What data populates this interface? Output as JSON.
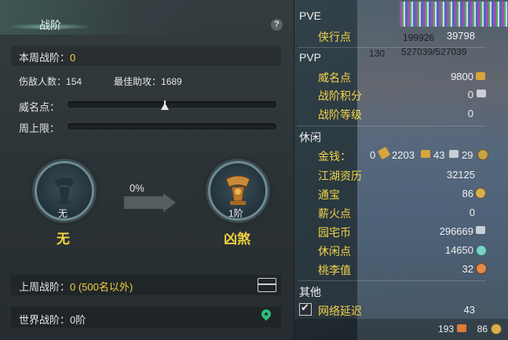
{
  "left": {
    "title": "战阶",
    "help": "?",
    "weekly_rank_label": "本周战阶：",
    "weekly_rank_value": "0",
    "kills_label": "伤敌人数：",
    "kills_value": "154",
    "best_assist_label": "最佳助攻：",
    "best_assist_value": "1689",
    "prestige_label": "威名点：",
    "weekly_cap_label": "周上限：",
    "current_medal_label": "无",
    "current_medal_name": "无",
    "progress_percent": "0%",
    "next_medal_label": "1阶",
    "next_medal_name": "凶煞",
    "last_week_label": "上周战阶：",
    "last_week_value": "0 (500名以外)",
    "world_rank_label": "世界战阶：0阶"
  },
  "right": {
    "pve_header": "PVE",
    "pve_items": [
      {
        "label": "侠行点",
        "value": "39798"
      }
    ],
    "pvp_header": "PVP",
    "pvp_items": [
      {
        "label": "威名点",
        "value": "9800"
      },
      {
        "label": "战阶积分",
        "value": "0"
      },
      {
        "label": "战阶等级",
        "value": "0"
      }
    ],
    "leisure_header": "休闲",
    "gold_label": "金钱：",
    "gold_a": "0",
    "gold_b": "2203",
    "gold_c": "43",
    "gold_d": "29",
    "leisure_items": [
      {
        "label": "江湖资历",
        "value": "32125"
      },
      {
        "label": "通宝",
        "value": "86"
      },
      {
        "label": "薪火点",
        "value": "0"
      },
      {
        "label": "园宅币",
        "value": "296669"
      },
      {
        "label": "休闲点",
        "value": "14650"
      },
      {
        "label": "桃李值",
        "value": "32"
      }
    ],
    "other_header": "其他",
    "latency_label": "网络延迟",
    "latency_value": "43",
    "bg_numbers": [
      "199926",
      "130",
      "527039/527039"
    ],
    "bottom_a": "193",
    "bottom_b": "86"
  },
  "colors": {
    "accent_yellow": "#f0d23c",
    "panel": "#2e3436"
  }
}
